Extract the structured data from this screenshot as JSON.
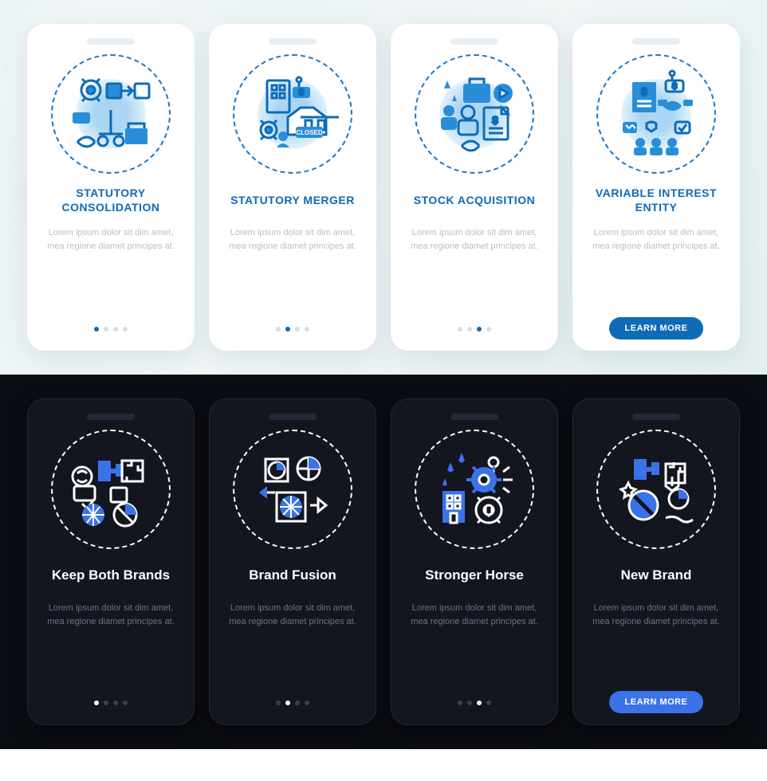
{
  "lorem": "Lorem ipsum dolor sit dim amet, mea regione diamet principes at.",
  "cta_label": "LEARN MORE",
  "light": {
    "cards": [
      {
        "title": "STATUTORY CONSOLIDATION",
        "icon": "consolidation-icon",
        "active": 0
      },
      {
        "title": "STATUTORY MERGER",
        "icon": "merger-icon",
        "active": 1
      },
      {
        "title": "STOCK ACQUISITION",
        "icon": "stock-icon",
        "active": 2
      },
      {
        "title": "VARIABLE INTEREST ENTITY",
        "icon": "vie-icon",
        "active": 3,
        "cta": true
      }
    ]
  },
  "dark": {
    "cards": [
      {
        "title": "Keep Both Brands",
        "icon": "keep-brands-icon",
        "active": 0
      },
      {
        "title": "Brand Fusion",
        "icon": "brand-fusion-icon",
        "active": 1
      },
      {
        "title": "Stronger Horse",
        "icon": "stronger-horse-icon",
        "active": 2
      },
      {
        "title": "New Brand",
        "icon": "new-brand-icon",
        "active": 3,
        "cta": true
      }
    ]
  }
}
